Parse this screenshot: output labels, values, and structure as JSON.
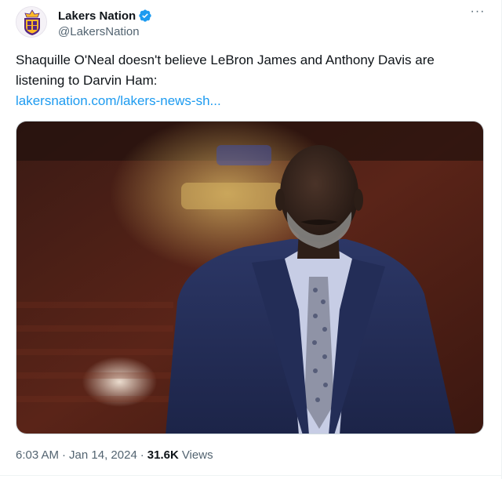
{
  "account": {
    "display_name": "Lakers Nation",
    "handle": "@LakersNation",
    "verified": true
  },
  "menu": {
    "more_label": "···"
  },
  "tweet": {
    "text": "Shaquille O'Neal doesn't believe LeBron James and Anthony Davis are listening to Darvin Ham:",
    "link_text": "lakersnation.com/lakers-news-sh..."
  },
  "meta": {
    "time": "6:03 AM",
    "separator": "·",
    "date": "Jan 14, 2024",
    "views_count": "31.6K",
    "views_label": "Views"
  },
  "colors": {
    "link": "#1d9bf0",
    "verified_badge": "#1d9bf0",
    "secondary_text": "#536471"
  },
  "icons": {
    "avatar": "lakers-nation-crest-logo",
    "verified": "verified-badge-icon",
    "more": "more-options-icon"
  }
}
